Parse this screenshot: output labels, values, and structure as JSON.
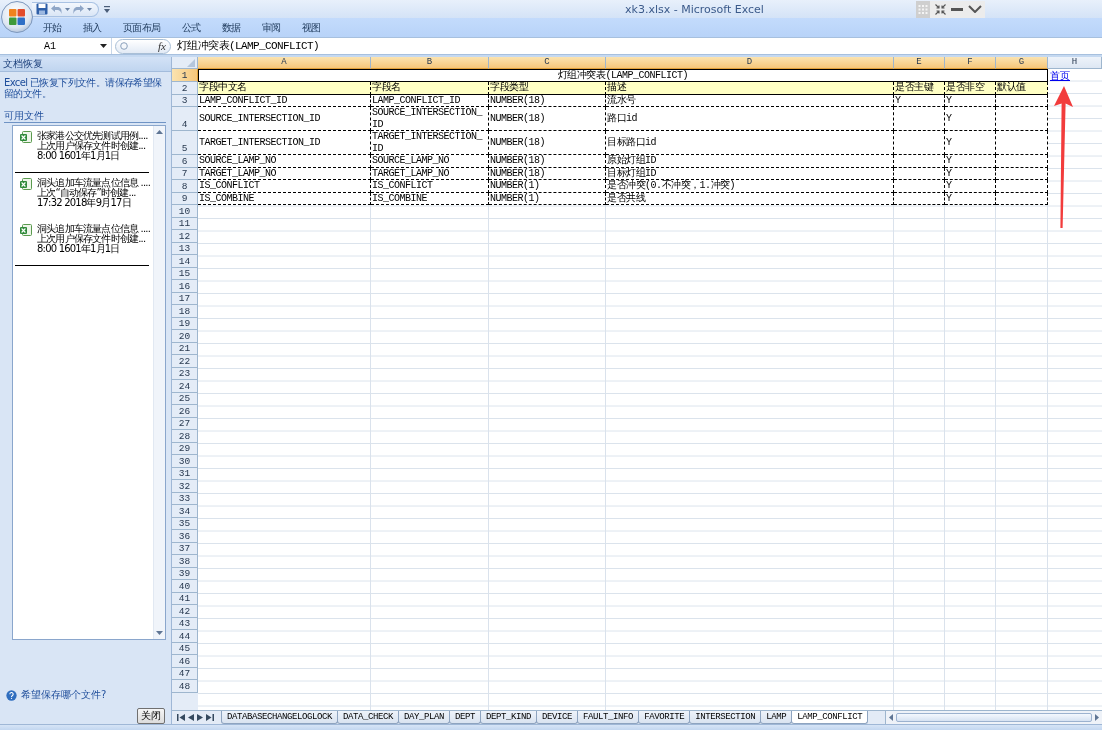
{
  "window": {
    "title": "xk3.xlsx - Microsoft Excel"
  },
  "ribbon_tabs": [
    {
      "label": "开始",
      "selected": false
    },
    {
      "label": "插入",
      "selected": false
    },
    {
      "label": "页面布局",
      "selected": false
    },
    {
      "label": "公式",
      "selected": false
    },
    {
      "label": "数据",
      "selected": false
    },
    {
      "label": "审阅",
      "selected": false
    },
    {
      "label": "视图",
      "selected": false
    }
  ],
  "formula_bar": {
    "name_box": "A1",
    "function_button": "fx",
    "content": "灯组冲突表(LAMP_CONFLICT)"
  },
  "recovery_pane": {
    "title": "文档恢复",
    "message": "Excel 已恢复下列文件。请保存希望保留的文件。",
    "list_heading": "可用文件",
    "files": [
      {
        "versions": [
          {
            "name": "张家港公交优先测试用例....",
            "note": "上次用户保存文件时创建...",
            "time": "8:00 1601年1月1日"
          }
        ]
      },
      {
        "versions": [
          {
            "name": "洞头追加车流量点位信息 ....",
            "note": "上次“自动保存”时创建...",
            "time": "17:32 2018年9月17日"
          },
          {
            "name": "洞头追加车流量点位信息 ....",
            "note": "上次用户保存文件时创建...",
            "time": "8:00 1601年1月1日"
          }
        ]
      }
    ],
    "help_link": "希望保存哪个文件?",
    "close_button": "关闭"
  },
  "sheet": {
    "columns": [
      {
        "label": "A",
        "selected": true
      },
      {
        "label": "B",
        "selected": true
      },
      {
        "label": "C",
        "selected": true
      },
      {
        "label": "D",
        "selected": true
      },
      {
        "label": "E",
        "selected": true
      },
      {
        "label": "F",
        "selected": true
      },
      {
        "label": "G",
        "selected": true
      },
      {
        "label": "H",
        "selected": false
      }
    ],
    "rows": [
      {
        "number": "1",
        "selected": true,
        "kind": "title",
        "title": "灯组冲突表(LAMP_CONFLICT)",
        "link": "首页"
      },
      {
        "number": "2",
        "selected": false,
        "kind": "header",
        "cells": {
          "A": "字段中文名",
          "B": "字段名",
          "C": "字段类型",
          "D": "描述",
          "E": "是否主键",
          "F": "是否非空",
          "G": "默认值"
        }
      },
      {
        "number": "3",
        "selected": false,
        "kind": "data",
        "cells": {
          "A": "LAMP_CONFLICT_ID",
          "B": "LAMP_CONFLICT_ID",
          "C": "NUMBER(18)",
          "D": "流水号",
          "E": "Y",
          "F": "Y"
        }
      },
      {
        "number": "4",
        "selected": false,
        "kind": "data",
        "cells": {
          "A": "SOURCE_INTERSECTION_ID",
          "B": "SOURCE_INTERSECTION_ID",
          "C": "NUMBER(18)",
          "D": "路口id",
          "F": "Y"
        }
      },
      {
        "number": "5",
        "selected": false,
        "kind": "data",
        "cells": {
          "A": "TARGET_INTERSECTION_ID",
          "B": "TARGET_INTERSECTION_ID",
          "C": "NUMBER(18)",
          "D": "目标路口id",
          "F": "Y"
        }
      },
      {
        "number": "6",
        "selected": false,
        "kind": "data",
        "cells": {
          "A": "SOURCE_LAMP_NO",
          "B": "SOURCE_LAMP_NO",
          "C": "NUMBER(18)",
          "D": "原始灯组ID",
          "F": "Y"
        }
      },
      {
        "number": "7",
        "selected": false,
        "kind": "data",
        "cells": {
          "A": "TARGET_LAMP_NO",
          "B": "TARGET_LAMP_NO",
          "C": "NUMBER(18)",
          "D": "目标灯组ID",
          "F": "Y"
        }
      },
      {
        "number": "8",
        "selected": false,
        "kind": "data",
        "cells": {
          "A": "IS_CONFLICT",
          "B": "IS_CONFLICT",
          "C": "NUMBER(1)",
          "D": "是否冲突(0.不冲突，1.冲突)",
          "F": "Y"
        }
      },
      {
        "number": "9",
        "selected": false,
        "kind": "data",
        "cells": {
          "A": "IS_COMBINE",
          "B": "IS_COMBINE",
          "C": "NUMBER(1)",
          "D": "是否共线",
          "F": "Y"
        }
      },
      {
        "number": "10",
        "selected": false,
        "kind": "empty"
      },
      {
        "number": "11",
        "selected": false,
        "kind": "empty"
      },
      {
        "number": "12",
        "selected": false,
        "kind": "empty"
      },
      {
        "number": "13",
        "selected": false,
        "kind": "empty"
      },
      {
        "number": "14",
        "selected": false,
        "kind": "empty"
      },
      {
        "number": "15",
        "selected": false,
        "kind": "empty"
      },
      {
        "number": "16",
        "selected": false,
        "kind": "empty"
      },
      {
        "number": "17",
        "selected": false,
        "kind": "empty"
      },
      {
        "number": "18",
        "selected": false,
        "kind": "empty"
      },
      {
        "number": "19",
        "selected": false,
        "kind": "empty"
      },
      {
        "number": "20",
        "selected": false,
        "kind": "empty"
      },
      {
        "number": "21",
        "selected": false,
        "kind": "empty"
      },
      {
        "number": "22",
        "selected": false,
        "kind": "empty"
      },
      {
        "number": "23",
        "selected": false,
        "kind": "empty"
      },
      {
        "number": "24",
        "selected": false,
        "kind": "empty"
      },
      {
        "number": "25",
        "selected": false,
        "kind": "empty"
      },
      {
        "number": "26",
        "selected": false,
        "kind": "empty"
      },
      {
        "number": "27",
        "selected": false,
        "kind": "empty"
      },
      {
        "number": "28",
        "selected": false,
        "kind": "empty"
      },
      {
        "number": "29",
        "selected": false,
        "kind": "empty"
      },
      {
        "number": "30",
        "selected": false,
        "kind": "empty"
      },
      {
        "number": "31",
        "selected": false,
        "kind": "empty"
      },
      {
        "number": "32",
        "selected": false,
        "kind": "empty"
      },
      {
        "number": "33",
        "selected": false,
        "kind": "empty"
      },
      {
        "number": "34",
        "selected": false,
        "kind": "empty"
      },
      {
        "number": "35",
        "selected": false,
        "kind": "empty"
      },
      {
        "number": "36",
        "selected": false,
        "kind": "empty"
      },
      {
        "number": "37",
        "selected": false,
        "kind": "empty"
      },
      {
        "number": "38",
        "selected": false,
        "kind": "empty"
      },
      {
        "number": "39",
        "selected": false,
        "kind": "empty"
      },
      {
        "number": "40",
        "selected": false,
        "kind": "empty"
      },
      {
        "number": "41",
        "selected": false,
        "kind": "empty"
      },
      {
        "number": "42",
        "selected": false,
        "kind": "empty"
      },
      {
        "number": "43",
        "selected": false,
        "kind": "empty"
      },
      {
        "number": "44",
        "selected": false,
        "kind": "empty"
      },
      {
        "number": "45",
        "selected": false,
        "kind": "empty"
      },
      {
        "number": "46",
        "selected": false,
        "kind": "empty"
      },
      {
        "number": "47",
        "selected": false,
        "kind": "empty"
      },
      {
        "number": "48",
        "selected": false,
        "kind": "empty"
      }
    ]
  },
  "sheet_tabs": [
    {
      "label": "DATABASECHANGELOGLOCK",
      "selected": false
    },
    {
      "label": "DATA_CHECK",
      "selected": false
    },
    {
      "label": "DAY_PLAN",
      "selected": false
    },
    {
      "label": "DEPT",
      "selected": false
    },
    {
      "label": "DEPT_KIND",
      "selected": false
    },
    {
      "label": "DEVICE",
      "selected": false
    },
    {
      "label": "FAULT_INFO",
      "selected": false
    },
    {
      "label": "FAVORITE",
      "selected": false
    },
    {
      "label": "INTERSECTION",
      "selected": false
    },
    {
      "label": "LAMP",
      "selected": false
    },
    {
      "label": "LAMP_CONFLICT",
      "selected": true
    }
  ]
}
